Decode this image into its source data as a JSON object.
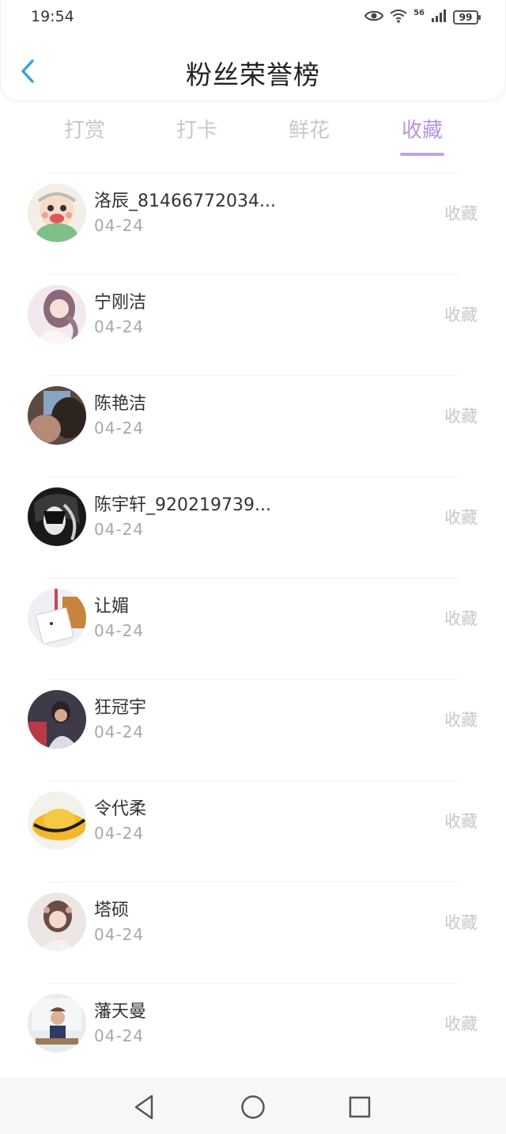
{
  "status_bar": {
    "time": "19:54",
    "signal_badge": "56",
    "battery": "99"
  },
  "header": {
    "title": "粉丝荣誉榜",
    "back_icon": "chevron-left-icon"
  },
  "tabs": [
    {
      "label": "打赏",
      "active": false
    },
    {
      "label": "打卡",
      "active": false
    },
    {
      "label": "鲜花",
      "active": false
    },
    {
      "label": "收藏",
      "active": true
    }
  ],
  "colors": {
    "accent": "#b794d9",
    "back_arrow": "#3aa0e6",
    "muted": "#c8c8c8"
  },
  "list": [
    {
      "name": "洛辰_81466772034...",
      "date": "04-24",
      "action": "收藏"
    },
    {
      "name": "宁刚洁",
      "date": "04-24",
      "action": "收藏"
    },
    {
      "name": "陈艳洁",
      "date": "04-24",
      "action": "收藏"
    },
    {
      "name": "陈宇轩_920219739...",
      "date": "04-24",
      "action": "收藏"
    },
    {
      "name": "让媚",
      "date": "04-24",
      "action": "收藏"
    },
    {
      "name": "狂冠宇",
      "date": "04-24",
      "action": "收藏"
    },
    {
      "name": "令代柔",
      "date": "04-24",
      "action": "收藏"
    },
    {
      "name": "塔硕",
      "date": "04-24",
      "action": "收藏"
    },
    {
      "name": "藩天曼",
      "date": "04-24",
      "action": "收藏"
    }
  ],
  "nav_bar": {
    "back": "triangle-back-icon",
    "home": "circle-home-icon",
    "recents": "square-recents-icon"
  }
}
